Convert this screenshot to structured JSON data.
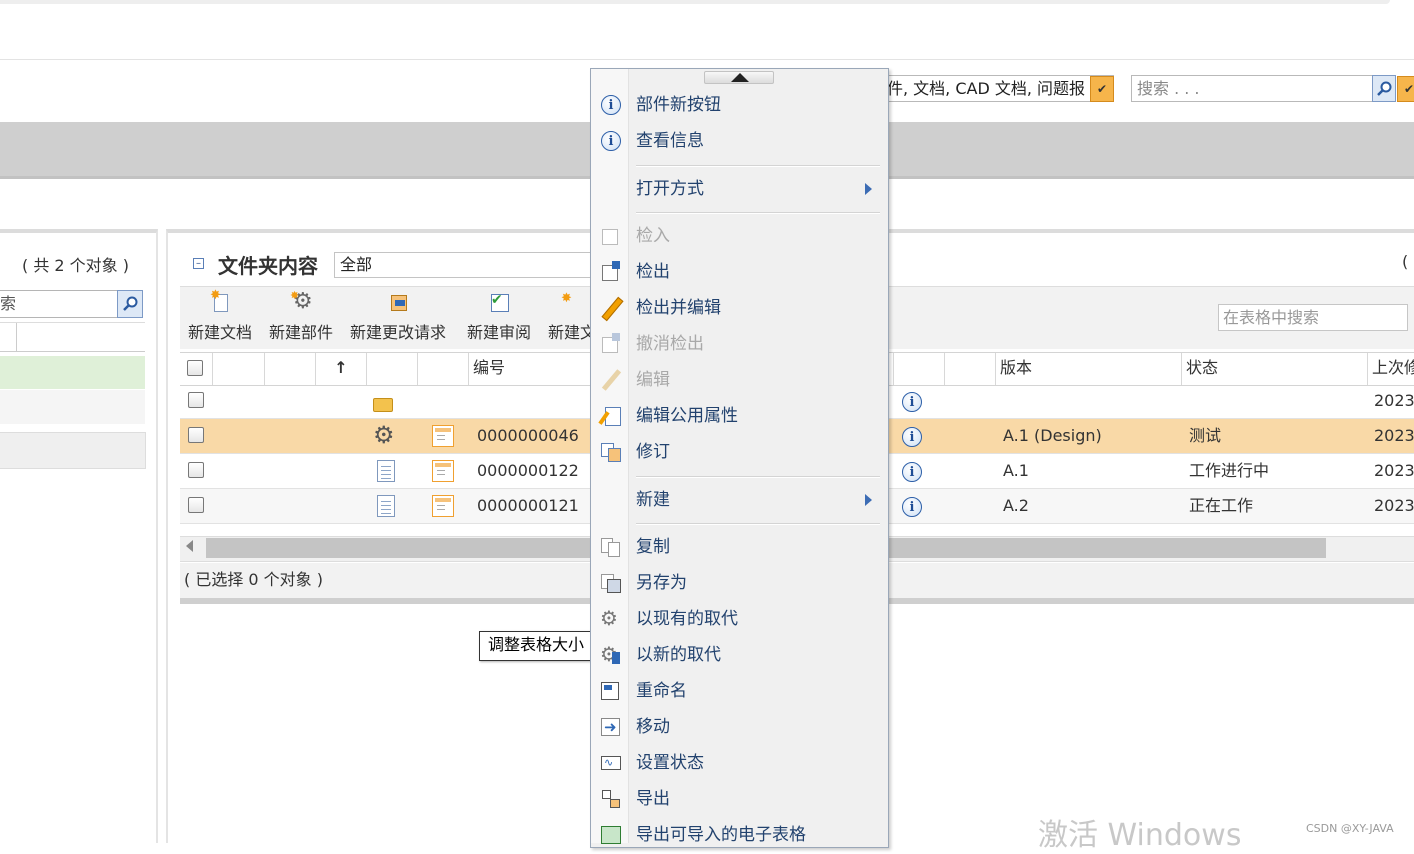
{
  "header": {
    "type_filter_value": "件, 文档, CAD 文档, 问题报",
    "search_placeholder": "搜索 . . ."
  },
  "left_panel": {
    "count_label": "( 共 2 个对象 )",
    "search_value": "索"
  },
  "folder_panel": {
    "title": "文件夹内容",
    "view_value": "全部",
    "right_paren": "(",
    "toolbar": {
      "new_document": "新建文档",
      "new_part": "新建部件",
      "new_change_request": "新建更改请求",
      "new_review": "新建审阅",
      "new_partial": "新建文"
    },
    "table_search_placeholder": "在表格中搜索",
    "columns": {
      "sort_arrow": "↑",
      "number": "编号",
      "version": "版本",
      "state": "状态",
      "last_modified": "上次修"
    },
    "rows": [
      {
        "number": "",
        "version": "",
        "state": "",
        "date": "2023"
      },
      {
        "number": "0000000046",
        "version": "A.1 (Design)",
        "state": "测试",
        "date": "2023"
      },
      {
        "number": "0000000122",
        "version": "A.1",
        "state": "工作进行中",
        "date": "2023"
      },
      {
        "number": "0000000121",
        "version": "A.2",
        "state": "正在工作",
        "date": "2023"
      }
    ],
    "selected_count": "( 已选择 0 个对象 )",
    "row_highlight_color": "#f9d9a7"
  },
  "tooltip": "调整表格大小",
  "context_menu": {
    "part_new_button": "部件新按钮",
    "view_info": "查看信息",
    "open_with": "打开方式",
    "check_in": "检入",
    "check_out": "检出",
    "check_out_edit": "检出并编辑",
    "undo_check_out": "撤消检出",
    "edit": "编辑",
    "edit_common_attrs": "编辑公用属性",
    "revise": "修订",
    "new": "新建",
    "copy": "复制",
    "save_as": "另存为",
    "replace_existing": "以现有的取代",
    "replace_new": "以新的取代",
    "rename": "重命名",
    "move": "移动",
    "set_state": "设置状态",
    "export": "导出",
    "export_spreadsheet": "导出可导入的电子表格"
  },
  "os_watermark": "激活 Windows",
  "credit": "CSDN @XY-JAVA"
}
